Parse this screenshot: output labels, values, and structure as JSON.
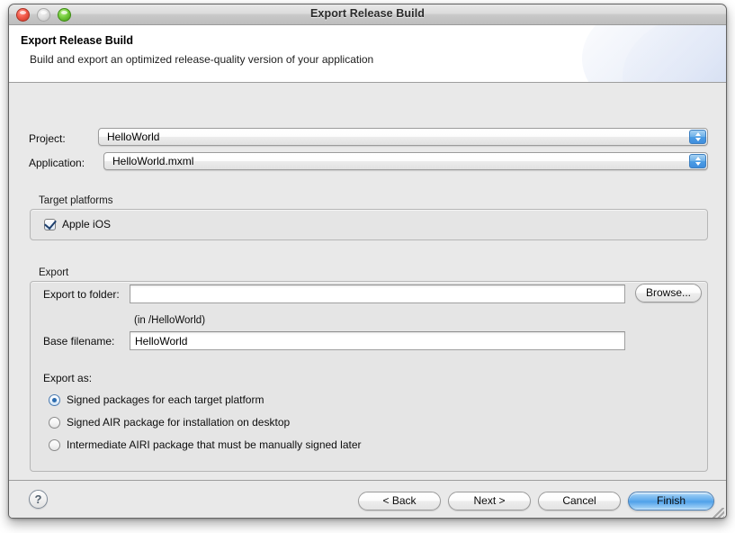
{
  "window": {
    "title": "Export Release Build",
    "traffic_lights": [
      "close-button",
      "minimize-button",
      "zoom-button"
    ]
  },
  "banner": {
    "heading": "Export Release Build",
    "description": "Build and export an optimized release-quality version of your application"
  },
  "form": {
    "project": {
      "label": "Project:",
      "value": "HelloWorld"
    },
    "application": {
      "label": "Application:",
      "value": "HelloWorld.mxml"
    }
  },
  "target_platforms": {
    "group_title": "Target platforms",
    "items": [
      {
        "label": "Apple iOS",
        "checked": true
      }
    ]
  },
  "export": {
    "group_title": "Export",
    "folder": {
      "label": "Export to folder:",
      "value": "",
      "placeholder": ""
    },
    "browse_label": "Browse...",
    "folder_hint": "(in /HelloWorld)",
    "base_filename": {
      "label": "Base filename:",
      "value": "HelloWorld"
    },
    "export_as_label": "Export as:",
    "options": [
      {
        "label": "Signed packages for each target platform",
        "selected": true
      },
      {
        "label": "Signed AIR package for installation on desktop",
        "selected": false
      },
      {
        "label": "Intermediate AIRI package that must be manually signed later",
        "selected": false
      }
    ]
  },
  "footer": {
    "help_label": "?",
    "back_label": "< Back",
    "next_label": "Next >",
    "cancel_label": "Cancel",
    "finish_label": "Finish"
  },
  "colors": {
    "accent": "#4d9fe9",
    "window_bg": "#e9e9e9",
    "banner_bg": "#ffffff",
    "border": "#9d9d9d"
  }
}
